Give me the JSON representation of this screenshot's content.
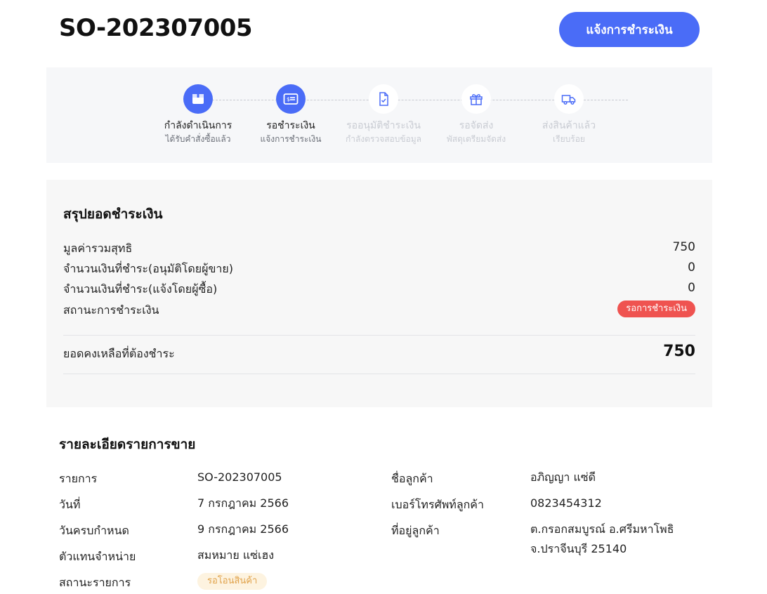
{
  "header": {
    "order_number": "SO-202307005",
    "notify_payment_label": "แจ้งการชำระเงิน"
  },
  "steps": [
    {
      "title": "กำลังดำเนินการ",
      "subtitle": "ได้รับคำสั่งซื้อแล้ว",
      "icon": "box-icon",
      "state": "done"
    },
    {
      "title": "รอชำระเงิน",
      "subtitle": "แจ้งการชำระเงิน",
      "icon": "money-card-icon",
      "state": "done"
    },
    {
      "title": "รออนุมัติชำระเงิน",
      "subtitle": "กำลังตรวจสอบข้อมูล",
      "icon": "document-check-icon",
      "state": "todo"
    },
    {
      "title": "รอจัดส่ง",
      "subtitle": "พัสดุเตรียมจัดส่ง",
      "icon": "gift-box-icon",
      "state": "todo"
    },
    {
      "title": "ส่งสินค้าแล้ว",
      "subtitle": "เรียบร้อย",
      "icon": "truck-icon",
      "state": "todo"
    }
  ],
  "summary": {
    "heading": "สรุปยอดชำระเงิน",
    "net_total_label": "มูลค่ารวมสุทธิ",
    "net_total_value": "750",
    "paid_seller_label": "จำนวนเงินที่ชำระ(อนุมัติโดยผู้ขาย)",
    "paid_seller_value": "0",
    "paid_buyer_label": "จำนวนเงินที่ชำระ(แจ้งโดยผู้ซื้อ)",
    "paid_buyer_value": "0",
    "payment_status_label": "สถานะการชำระเงิน",
    "payment_status_value": "รอการชำระเงิน",
    "balance_label": "ยอดคงเหลือที่ต้องชำระ",
    "balance_value": "750"
  },
  "details": {
    "heading": "รายละเอียดรายการขาย",
    "item_label": "รายการ",
    "item_value": "SO-202307005",
    "date_label": "วันที่",
    "date_value": "7 กรกฎาคม 2566",
    "due_label": "วันครบกำหนด",
    "due_value": "9 กรกฎาคม 2566",
    "agent_label": "ตัวแทนจำหน่าย",
    "agent_value": "สมหมาย แซ่เฮง",
    "status_label": "สถานะรายการ",
    "status_value": "รอโอนสินค้า",
    "customer_name_label": "ชื่อลูกค้า",
    "customer_name_value": "อภิญญา แซ่ดี",
    "customer_phone_label": "เบอร์โทรศัพท์ลูกค้า",
    "customer_phone_value": "0823454312",
    "customer_address_label": "ที่อยู่ลูกค้า",
    "customer_address_line1": "ต.กรอกสมบูรณ์ อ.ศรีมหาโพธิ",
    "customer_address_line2": "จ.ปราจีนบุรี 25140"
  },
  "colors": {
    "primary": "#4a6cf7",
    "danger": "#ef5350",
    "pending_bg": "#fdf3e0",
    "pending_text": "#e0a24a"
  }
}
